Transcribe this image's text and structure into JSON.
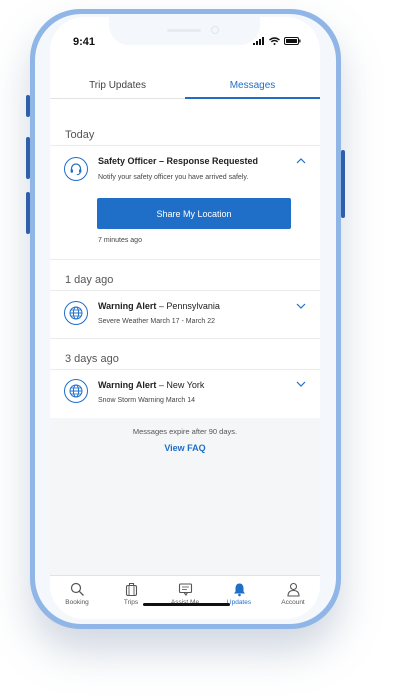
{
  "status": {
    "time": "9:41"
  },
  "tabs": [
    {
      "label": "Trip Updates",
      "active": false
    },
    {
      "label": "Messages",
      "active": true
    }
  ],
  "sections": {
    "today": "Today",
    "one_day": "1 day ago",
    "three_days": "3 days ago"
  },
  "messages": [
    {
      "icon": "headset-icon",
      "title_bold": "Safety Officer – Response Requested",
      "title_rest": "",
      "subtitle": "Notify your safety officer you have arrived safely.",
      "action_label": "Share My Location",
      "time_ago": "7 minutes ago",
      "expanded": true
    },
    {
      "icon": "globe-icon",
      "title_bold": "Warning Alert",
      "title_rest": " – Pennsylvania",
      "subtitle": "Severe Weather March 17 - March 22",
      "expanded": false
    },
    {
      "icon": "globe-icon",
      "title_bold": "Warning Alert",
      "title_rest": " – New York",
      "subtitle": "Snow Storm Warning March 14",
      "expanded": false
    }
  ],
  "footer": {
    "expire_note": "Messages expire after 90 days.",
    "faq_link": "View FAQ"
  },
  "nav": [
    {
      "label": "Booking",
      "icon": "search-icon",
      "active": false
    },
    {
      "label": "Trips",
      "icon": "luggage-icon",
      "active": false
    },
    {
      "label": "Assist Me",
      "icon": "chat-icon",
      "active": false
    },
    {
      "label": "Updates",
      "icon": "bell-icon",
      "active": true
    },
    {
      "label": "Account",
      "icon": "person-icon",
      "active": false
    }
  ],
  "colors": {
    "accent": "#1f6fc9",
    "device": "#8fb6e6",
    "side_buttons": "#2f5fa8"
  }
}
